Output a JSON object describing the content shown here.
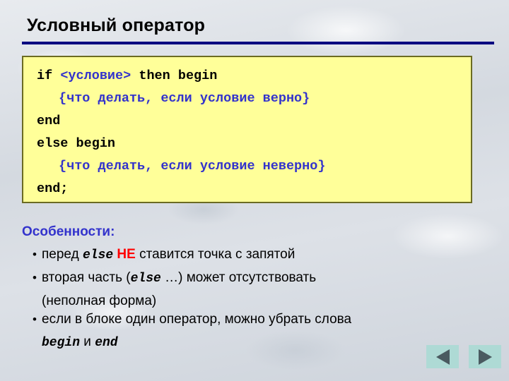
{
  "slide": {
    "title": "Условный оператор",
    "rule_color": "#000080",
    "background_color": "#d7dbe1"
  },
  "code_block": {
    "background_color": "#ffff99",
    "border_color": "#6b6b23",
    "keyword_color": "#000000",
    "comment_color": "#3333cc",
    "lines": [
      {
        "indent": false,
        "pre": "if ",
        "blue": "<условие>",
        "post": " then begin"
      },
      {
        "indent": true,
        "pre": "",
        "blue": "{что делать, если условие верно}",
        "post": ""
      },
      {
        "indent": false,
        "pre": "end",
        "blue": "",
        "post": ""
      },
      {
        "indent": false,
        "pre": "else begin",
        "blue": "",
        "post": ""
      },
      {
        "indent": true,
        "pre": "",
        "blue": "{что делать, если условие неверно}",
        "post": ""
      },
      {
        "indent": false,
        "pre": "end;",
        "blue": "",
        "post": ""
      }
    ]
  },
  "notes": {
    "heading": "Особенности:",
    "heading_color": "#3333cc",
    "bullet_glyph": "•",
    "items": [
      {
        "part1": "перед ",
        "mono1": "else",
        "red": " НЕ ",
        "part2": "ставится точка с запятой"
      },
      {
        "part1": "вторая часть (",
        "mono1": "else",
        "part2": " …) может отсутствовать",
        "continuation": "(неполная форма)"
      },
      {
        "part1": "если в блоке один оператор, можно убрать слова",
        "mono1": "begin",
        "part2": " и ",
        "mono2": "end"
      }
    ]
  },
  "nav": {
    "button_color": "#aedad5",
    "arrow_color": "#4a5a60",
    "back_label": "previous slide",
    "forward_label": "next slide"
  }
}
